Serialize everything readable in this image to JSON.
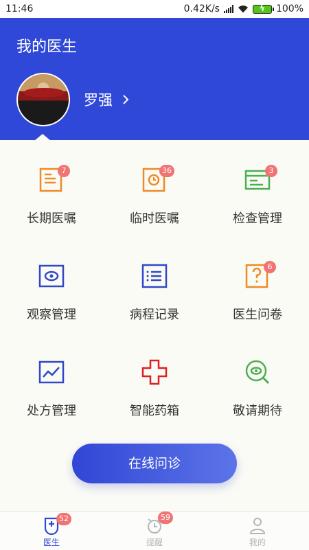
{
  "status_bar": {
    "time": "11:46",
    "network_speed": "0.42K/s",
    "battery_percent": "100%"
  },
  "header": {
    "title": "我的医生",
    "user_name": "罗强",
    "background_color": "#3048d8"
  },
  "grid": [
    {
      "label": "长期医嘱",
      "icon": "document-list-icon",
      "badge": "7",
      "color": "#f08a24"
    },
    {
      "label": "临时医嘱",
      "icon": "clock-document-icon",
      "badge": "36",
      "color": "#f08a24"
    },
    {
      "label": "检查管理",
      "icon": "checklist-card-icon",
      "badge": "3",
      "color": "#4caf50"
    },
    {
      "label": "观察管理",
      "icon": "eye-frame-icon",
      "badge": "",
      "color": "#3048c8"
    },
    {
      "label": "病程记录",
      "icon": "list-record-icon",
      "badge": "",
      "color": "#3048c8"
    },
    {
      "label": "医生问卷",
      "icon": "question-doc-icon",
      "badge": "6",
      "color": "#f08a24"
    },
    {
      "label": "处方管理",
      "icon": "trend-chart-icon",
      "badge": "",
      "color": "#3048c8"
    },
    {
      "label": "智能药箱",
      "icon": "medical-cross-icon",
      "badge": "",
      "color": "#e02020"
    },
    {
      "label": "敬请期待",
      "icon": "eye-search-icon",
      "badge": "",
      "color": "#4caf50"
    }
  ],
  "consult_button": {
    "label": "在线问诊"
  },
  "tabbar": {
    "items": [
      {
        "label": "医生",
        "icon": "doctor-shield-icon",
        "badge": "52",
        "active": true
      },
      {
        "label": "提醒",
        "icon": "alarm-clock-icon",
        "badge": "59",
        "active": false
      },
      {
        "label": "我的",
        "icon": "person-icon",
        "badge": "",
        "active": false
      }
    ],
    "active_color": "#3048d8",
    "inactive_color": "#b5b5b5"
  }
}
